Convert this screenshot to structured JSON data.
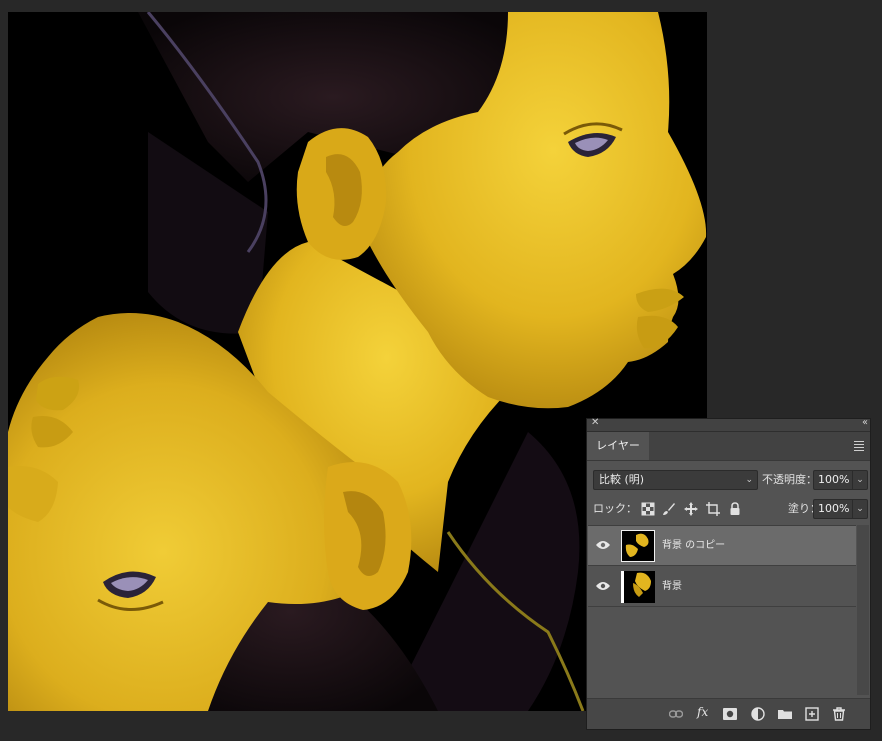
{
  "panel": {
    "close_glyph": "✕",
    "collapse_glyph": "‹‹",
    "tab_label": "レイヤー",
    "blend_mode": "比較 (明)",
    "opacity_label": "不透明度：",
    "opacity_value": "100%",
    "lock_label": "ロック：",
    "fill_label": "塗り：",
    "fill_value": "100%",
    "layers": [
      {
        "name": "背景 のコピー",
        "visible": true,
        "selected": true
      },
      {
        "name": "背景",
        "visible": true,
        "selected": false
      }
    ],
    "fx_label": "fx"
  },
  "colors": {
    "canvas_bg": "#000000",
    "skin": "#e2b51f",
    "panel_bg": "#535353",
    "selected_row": "#6b6b6b"
  },
  "icons": {
    "lock": [
      "transparent-pixels-lock-icon",
      "brush-lock-icon",
      "move-lock-icon",
      "artboard-lock-icon",
      "lock-all-icon"
    ],
    "bottom": [
      "link-icon",
      "fx-icon",
      "mask-icon",
      "adjustment-icon",
      "folder-icon",
      "new-layer-icon",
      "trash-icon"
    ]
  }
}
